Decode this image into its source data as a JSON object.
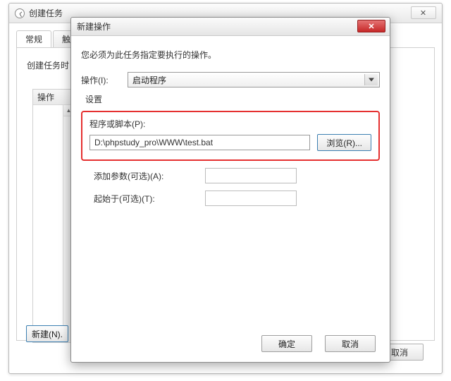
{
  "back": {
    "title": "创建任务",
    "close_glyph": "✕",
    "tabs": [
      "常规",
      "触"
    ],
    "subtitle": "创建任务时",
    "list_header": "操作",
    "new_button": "新建(N).",
    "cancel_button": "取消"
  },
  "front": {
    "title": "新建操作",
    "close_glyph": "✕",
    "intro": "您必须为此任务指定要执行的操作。",
    "action_label": "操作(I):",
    "action_value": "启动程序",
    "settings_label": "设置",
    "program_label": "程序或脚本(P):",
    "program_value": "D:\\phpstudy_pro\\WWW\\test.bat",
    "browse_button": "浏览(R)...",
    "args_label": "添加参数(可选)(A):",
    "args_value": "",
    "startin_label": "起始于(可选)(T):",
    "startin_value": "",
    "ok_button": "确定",
    "cancel_button": "取消"
  }
}
